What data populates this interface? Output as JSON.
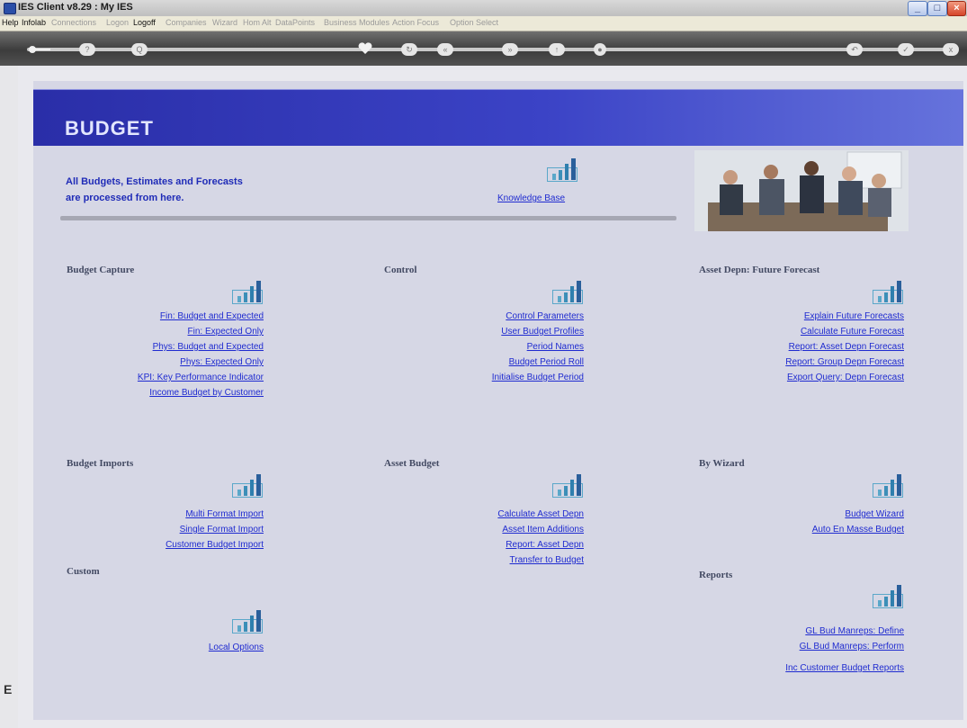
{
  "window": {
    "title": "IES Client v8.29 : My IES"
  },
  "menu": [
    {
      "label": "Help",
      "active": true
    },
    {
      "label": "Infolab",
      "active": true
    },
    {
      "label": "Connections",
      "active": false
    },
    {
      "label": "Logon",
      "active": false
    },
    {
      "label": "Logoff",
      "active": true
    },
    {
      "label": "Companies",
      "active": false
    },
    {
      "label": "Wizard",
      "active": false
    },
    {
      "label": "Hom Alt",
      "active": false
    },
    {
      "label": "DataPoints",
      "active": false
    },
    {
      "label": "Business Modules",
      "active": false
    },
    {
      "label": "Action Focus",
      "active": false
    },
    {
      "label": "Option Select",
      "active": false
    }
  ],
  "toolbar": {
    "help": "?",
    "search": "Q",
    "back": "«",
    "forward": "»",
    "close": "x"
  },
  "page": {
    "title": "BUDGET",
    "intro_line1": "All Budgets, Estimates and Forecasts",
    "intro_line2": "are processed from here.",
    "knowledge_base": "Knowledge Base",
    "side_letter": "E"
  },
  "sections": {
    "budget_capture": {
      "title": "Budget Capture",
      "links": [
        "Fin: Budget and Expected",
        "Fin: Expected Only",
        "Phys: Budget and Expected",
        "Phys: Expected Only",
        "KPI: Key Performance Indicator",
        "Income Budget by Customer"
      ]
    },
    "control": {
      "title": "Control",
      "links": [
        "Control Parameters",
        "User Budget Profiles",
        "Period Names",
        "Budget Period Roll",
        "Initialise Budget Period"
      ]
    },
    "asset_depn": {
      "title": "Asset Depn: Future Forecast",
      "links": [
        "Explain Future Forecasts",
        "Calculate Future Forecast",
        "Report: Asset Depn Forecast",
        "Report: Group Depn Forecast",
        "Export Query: Depn Forecast"
      ]
    },
    "budget_imports": {
      "title": "Budget Imports",
      "links": [
        "Multi Format Import",
        "Single Format Import",
        "Customer Budget Import"
      ]
    },
    "asset_budget": {
      "title": "Asset Budget",
      "links": [
        "Calculate Asset Depn",
        "Asset Item Additions",
        "Report: Asset Depn",
        "Transfer to Budget"
      ]
    },
    "by_wizard": {
      "title": "By Wizard",
      "links": [
        "Budget Wizard",
        "Auto En Masse Budget"
      ]
    },
    "custom": {
      "title": "Custom",
      "links": [
        "Local Options"
      ]
    },
    "reports": {
      "title": "Reports",
      "links": [
        "GL Bud Manreps: Define",
        "GL Bud Manreps: Perform",
        "Inc Customer Budget Reports"
      ]
    }
  },
  "colors": {
    "accent": "#1f2bd0",
    "header": "#3b43c6",
    "panel": "#d6d7e5"
  }
}
